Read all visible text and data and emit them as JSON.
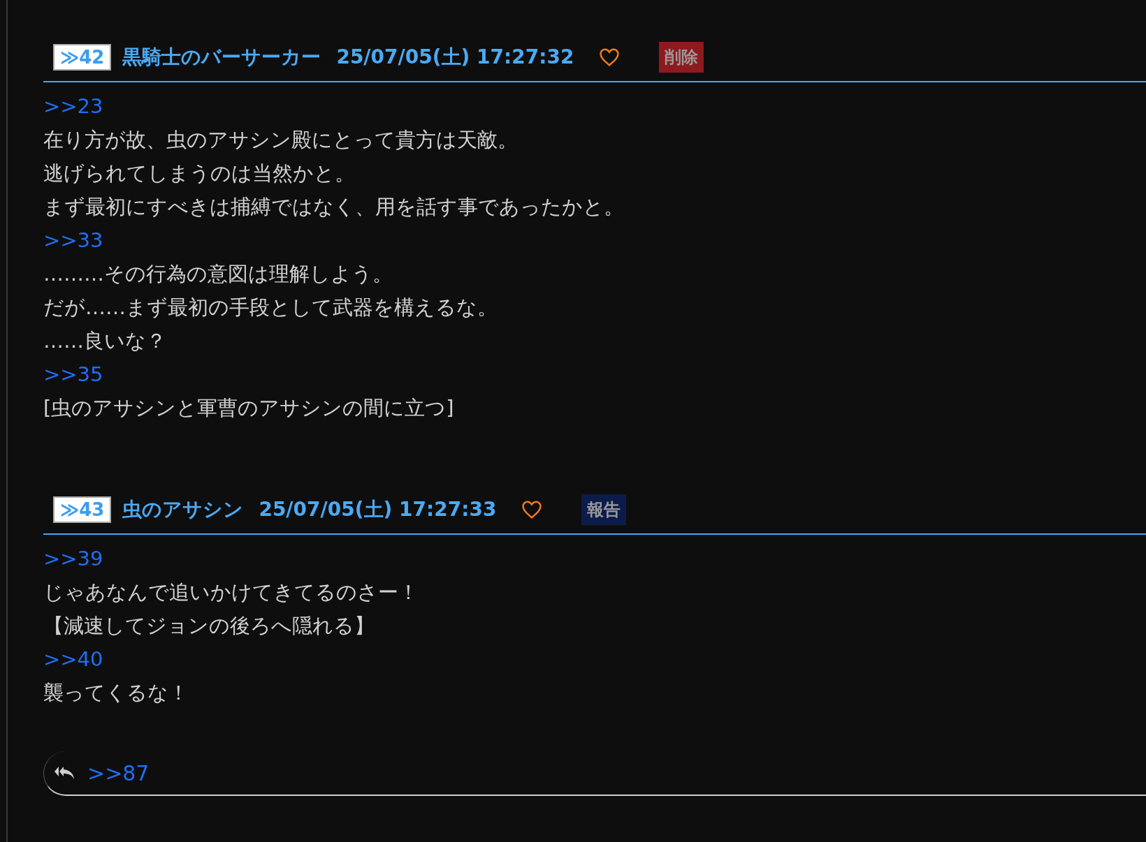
{
  "posts": [
    {
      "number": "≫42",
      "name": "黒騎士のバーサーカー",
      "date": "25/07/05(土) 17:27:32",
      "liked": false,
      "action": {
        "kind": "delete",
        "label": "削除"
      },
      "lines": [
        {
          "kind": "anchor",
          "text": ">>23"
        },
        {
          "kind": "text",
          "text": "在り方が故、虫のアサシン殿にとって貴方は天敵。"
        },
        {
          "kind": "text",
          "text": "逃げられてしまうのは当然かと。"
        },
        {
          "kind": "text",
          "text": "まず最初にすべきは捕縛ではなく、用を話す事であったかと。"
        },
        {
          "kind": "anchor",
          "text": ">>33"
        },
        {
          "kind": "text",
          "text": "………その行為の意図は理解しよう。"
        },
        {
          "kind": "text",
          "text": "だが……まず最初の手段として武器を構えるな。"
        },
        {
          "kind": "text",
          "text": "……良いな？"
        },
        {
          "kind": "anchor",
          "text": ">>35"
        },
        {
          "kind": "text",
          "text": "[虫のアサシンと軍曹のアサシンの間に立つ]"
        }
      ]
    },
    {
      "number": "≫43",
      "name": "虫のアサシン",
      "date": "25/07/05(土) 17:27:33",
      "liked": false,
      "action": {
        "kind": "report",
        "label": "報告"
      },
      "lines": [
        {
          "kind": "anchor",
          "text": ">>39"
        },
        {
          "kind": "text",
          "text": "じゃあなんで追いかけてきてるのさー！"
        },
        {
          "kind": "text",
          "text": "【減速してジョンの後ろへ隠れる】"
        },
        {
          "kind": "anchor",
          "text": ">>40"
        },
        {
          "kind": "text",
          "text": "襲ってくるな！"
        }
      ]
    }
  ],
  "replies": {
    "links": [
      ">>87"
    ]
  }
}
